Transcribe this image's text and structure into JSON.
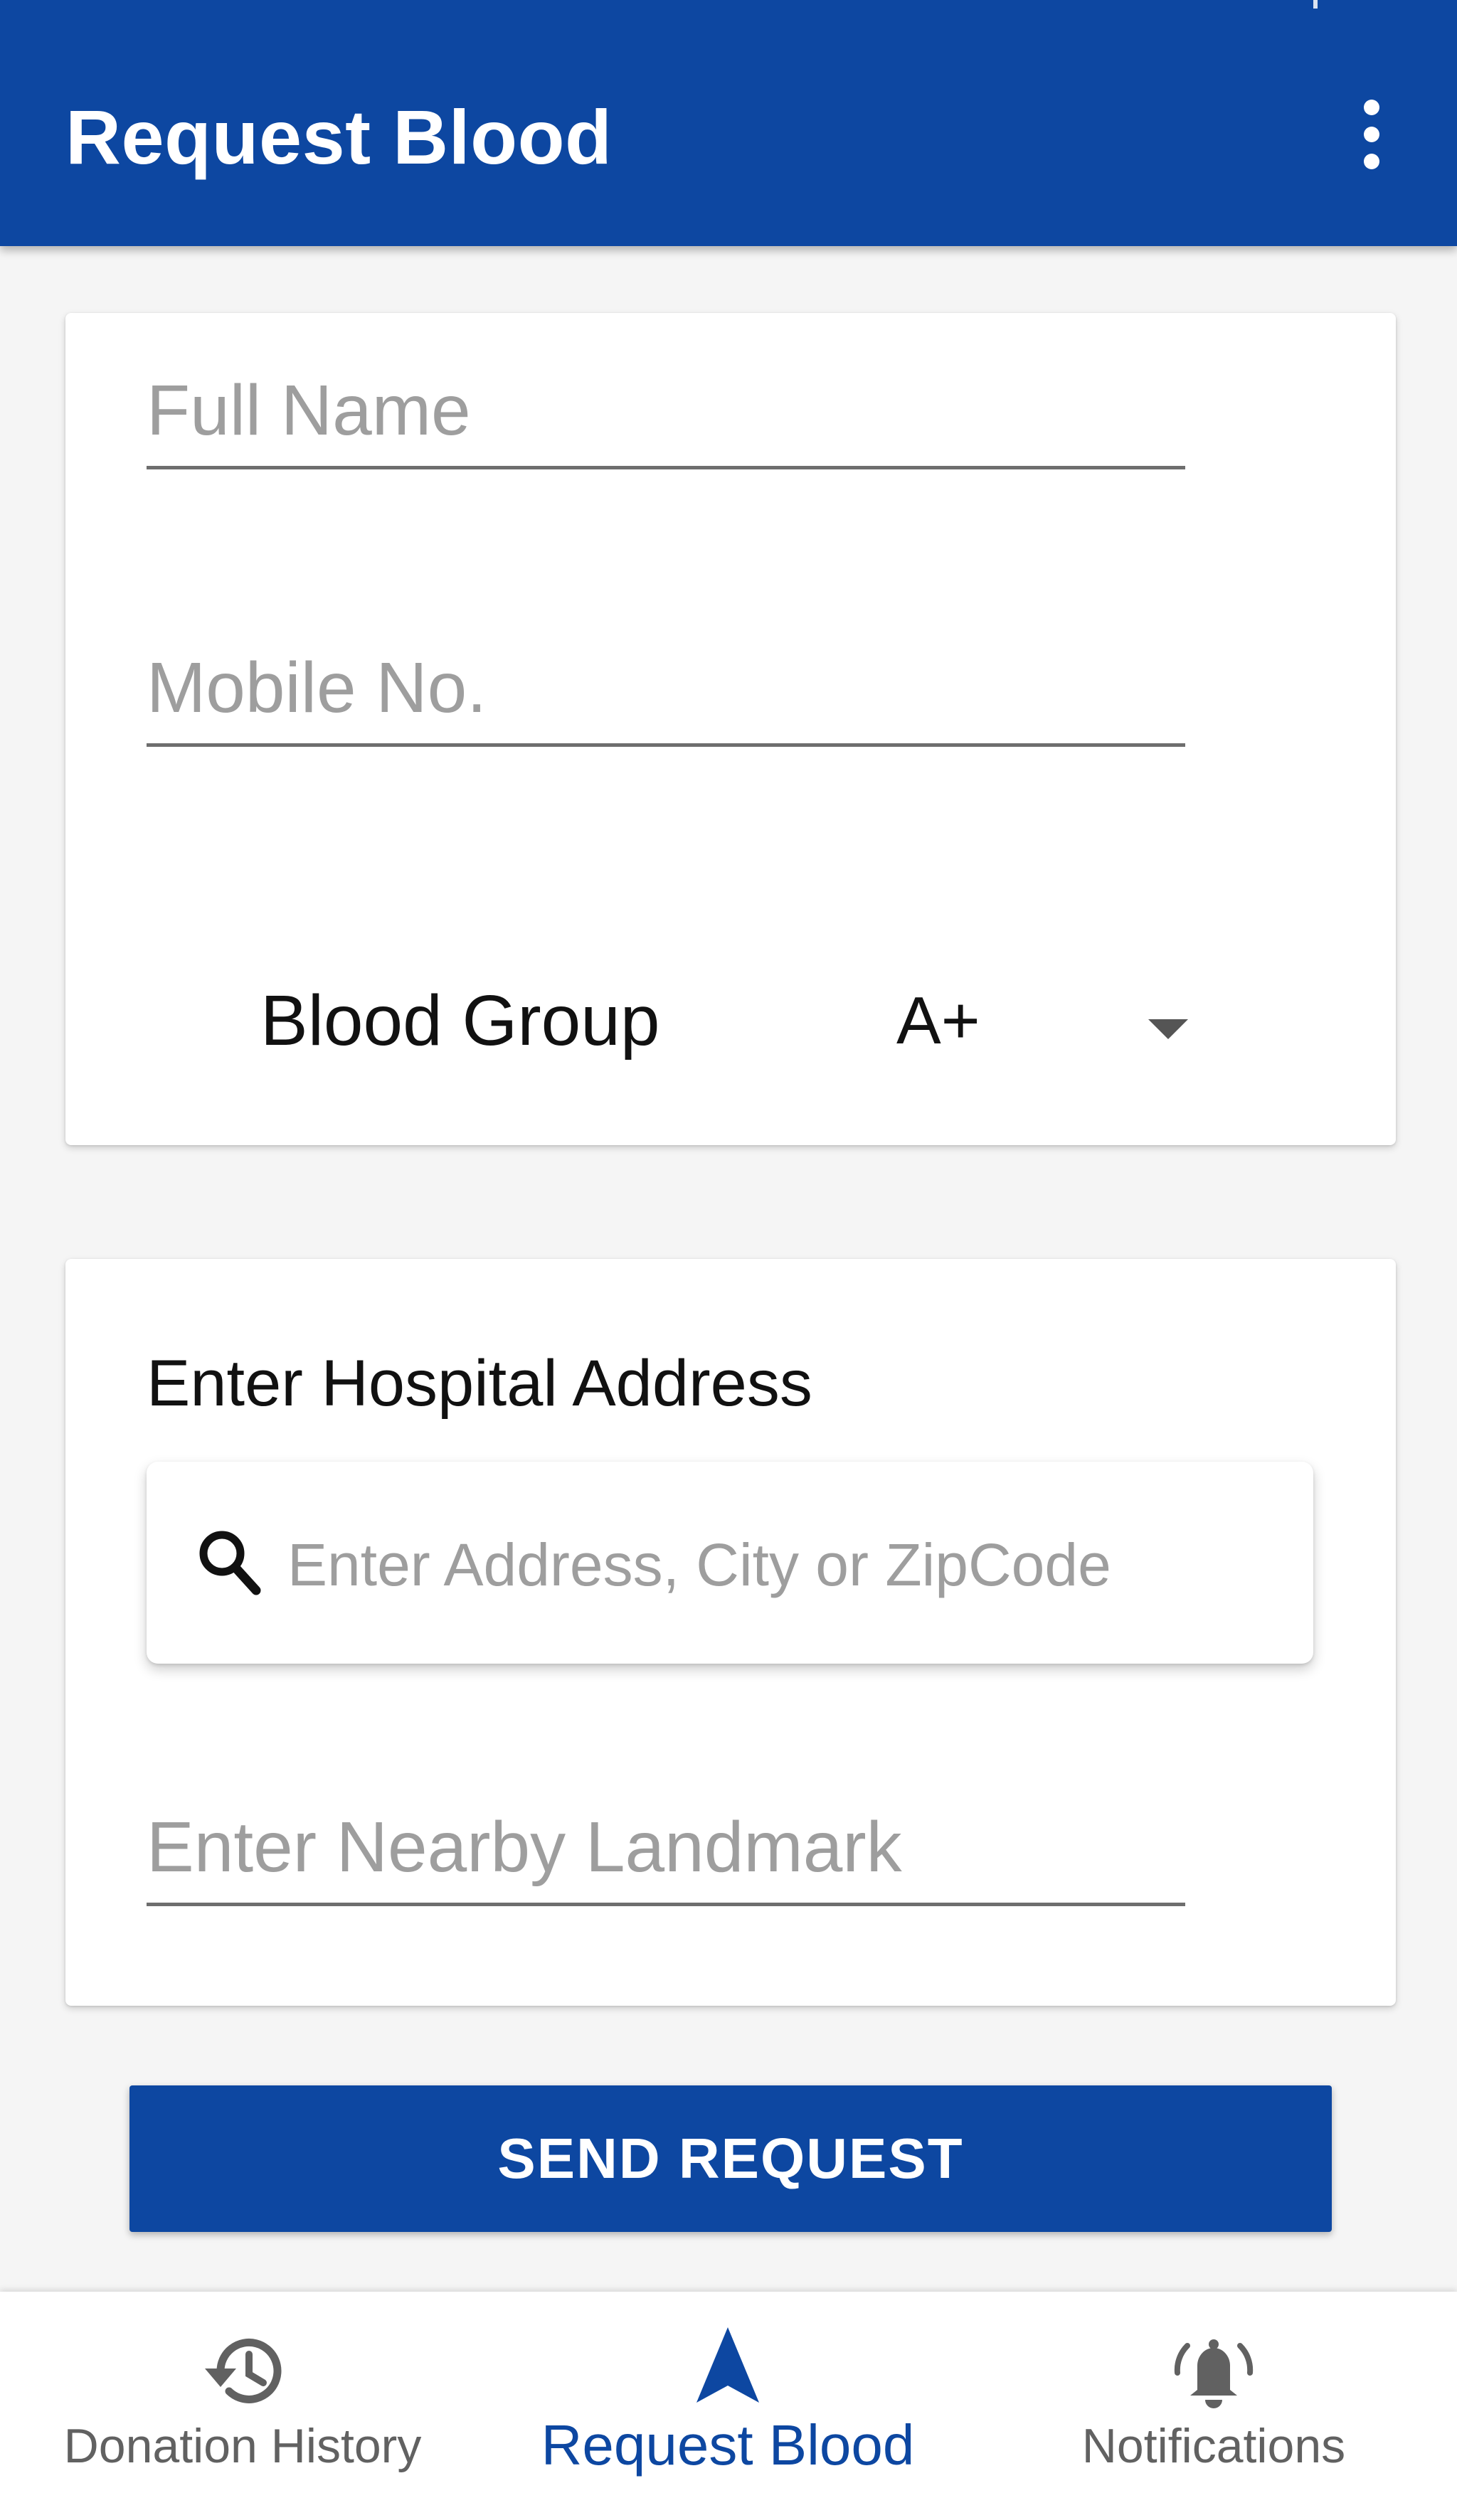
{
  "app_bar": {
    "title": "Request Blood",
    "overflow_icon": "more-vert-icon",
    "background_color": "#0d47a1"
  },
  "form": {
    "full_name": {
      "value": "",
      "placeholder": "Full Name"
    },
    "mobile": {
      "value": "",
      "placeholder": "Mobile No."
    },
    "blood_group": {
      "label": "Blood Group",
      "selected": "A+"
    }
  },
  "address": {
    "heading": "Enter Hospital Address",
    "search": {
      "icon": "search-icon",
      "value": "",
      "placeholder": "Enter Address, City or ZipCode"
    },
    "landmark": {
      "value": "",
      "placeholder": "Enter Nearby Landmark"
    }
  },
  "send_button": {
    "label": "SEND REQUEST"
  },
  "bottom_nav": {
    "items": [
      {
        "label": "Donation History",
        "icon": "history-icon",
        "active": false
      },
      {
        "label": "Request Blood",
        "icon": "navigation-arrow-icon",
        "active": true
      },
      {
        "label": "Notifications",
        "icon": "bell-ring-icon",
        "active": false
      }
    ],
    "active_color": "#0d47a1",
    "inactive_color": "#616161"
  }
}
